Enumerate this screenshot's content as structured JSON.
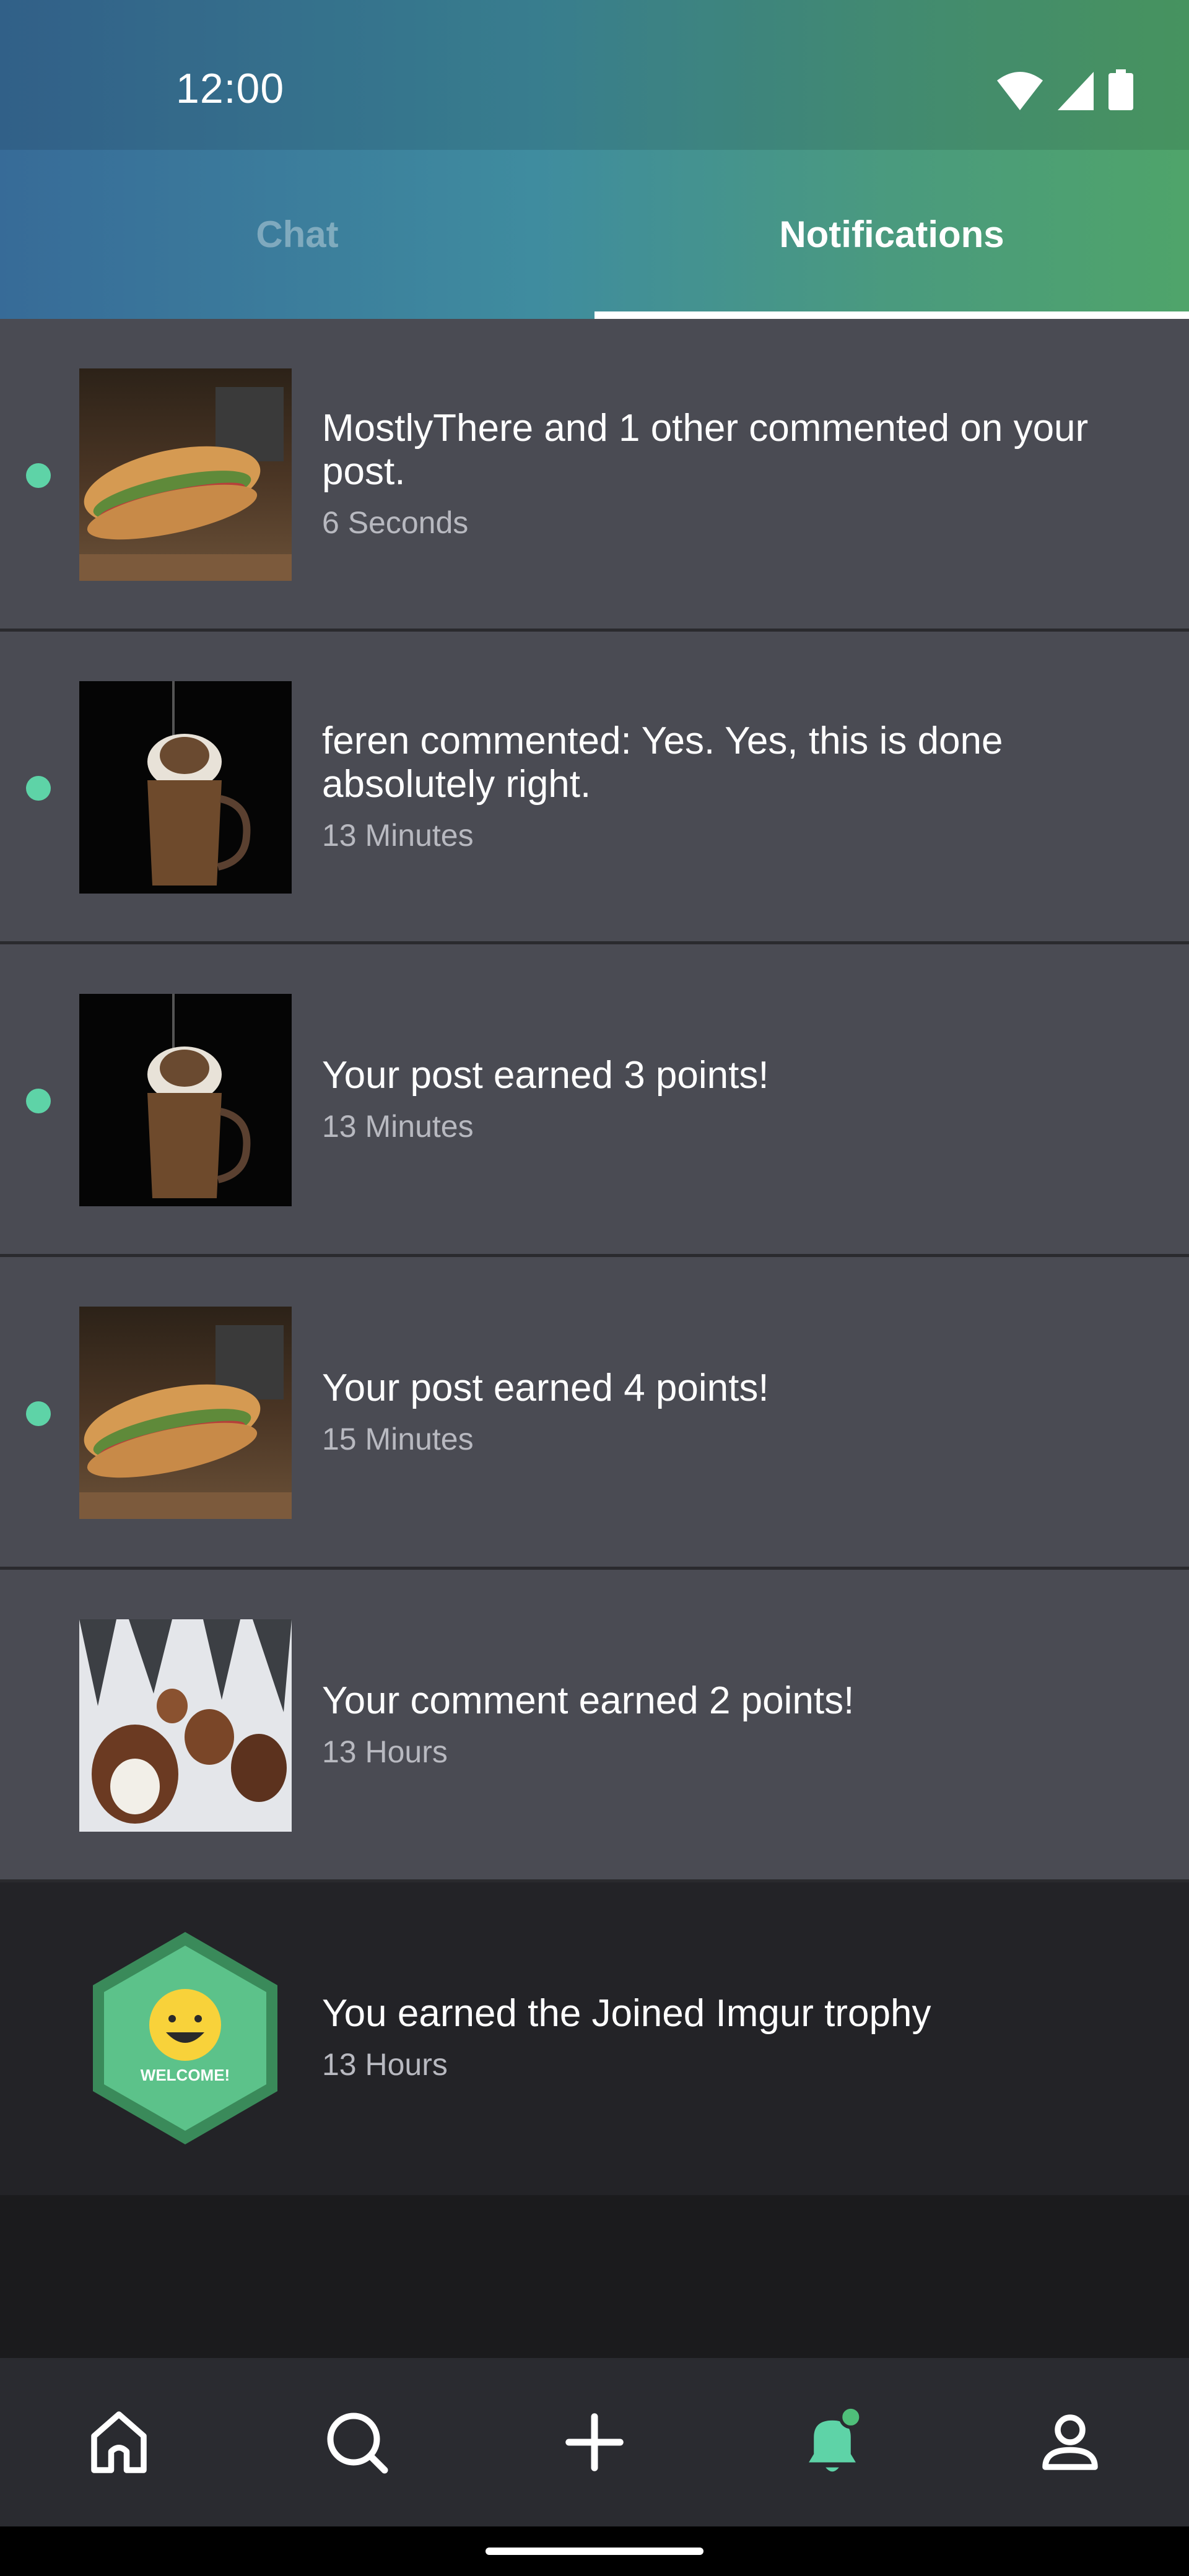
{
  "status_bar": {
    "time": "12:00"
  },
  "tabs": [
    {
      "label": "Chat",
      "active": false
    },
    {
      "label": "Notifications",
      "active": true
    }
  ],
  "notifications": [
    {
      "title": "MostlyThere and 1 other commented on your post.",
      "time": "6 Seconds",
      "unread": true,
      "thumbnail": "sandwich-image"
    },
    {
      "title": "feren commented: Yes. Yes, this is done absolutely right.",
      "time": "13 Minutes",
      "unread": true,
      "thumbnail": "milkshake-image"
    },
    {
      "title": "Your post earned 3 points!",
      "time": "13 Minutes",
      "unread": true,
      "thumbnail": "milkshake-image"
    },
    {
      "title": "Your post earned 4 points!",
      "time": "15 Minutes",
      "unread": true,
      "thumbnail": "sandwich-image"
    },
    {
      "title": "Your comment earned 2 points!",
      "time": "13 Hours",
      "unread": false,
      "thumbnail": "snow-dogs-image"
    },
    {
      "title": "You earned the Joined Imgur trophy",
      "time": "13 Hours",
      "unread": false,
      "thumbnail": "welcome-trophy-badge",
      "badge_text": "WELCOME!"
    }
  ],
  "bottom_nav": [
    "home-icon",
    "search-icon",
    "add-icon",
    "notifications-bell-icon",
    "profile-icon"
  ],
  "colors": {
    "unread_dot": "#5ed3a7",
    "row_bg": "#4a4b53",
    "accent_green": "#4fa46a"
  }
}
